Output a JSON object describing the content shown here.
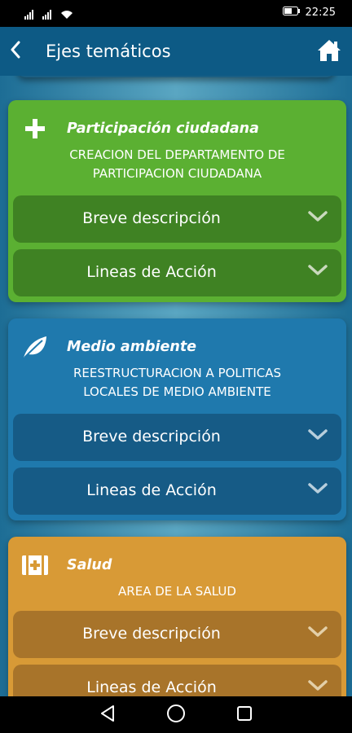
{
  "status_bar": {
    "time": "22:25",
    "icons": [
      "signal-icon",
      "signal-icon",
      "wifi-icon",
      "battery-icon"
    ]
  },
  "app_bar": {
    "title": "Ejes temáticos",
    "back_icon": "chevron-left-icon",
    "home_icon": "home-icon"
  },
  "cards": [
    {
      "title": "Participación ciudadana",
      "icon": "plus-icon",
      "color": "#5bb032",
      "description_line1": "CREACION DEL DEPARTAMENTO DE",
      "description_line2": "PARTICIPACION CIUDADANA",
      "breve_label": "Breve descripción",
      "lineas_label": "Lineas de Acción"
    },
    {
      "title": "Medio ambiente",
      "icon": "leaf-icon",
      "color": "#1f79ad",
      "description_line1": "REESTRUCTURACION A POLITICAS",
      "description_line2": "LOCALES DE MEDIO AMBIENTE",
      "breve_label": "Breve descripción",
      "lineas_label": "Lineas de Acción"
    },
    {
      "title": "Salud",
      "icon": "medical-kit-icon",
      "color": "#d89a36",
      "description_line1": "AREA DE LA SALUD",
      "breve_label": "Breve descripción",
      "lineas_label": "Lineas de Acción"
    }
  ],
  "nav_bar": {
    "icons": [
      "back-triangle-icon",
      "home-circle-icon",
      "recents-square-icon"
    ]
  }
}
